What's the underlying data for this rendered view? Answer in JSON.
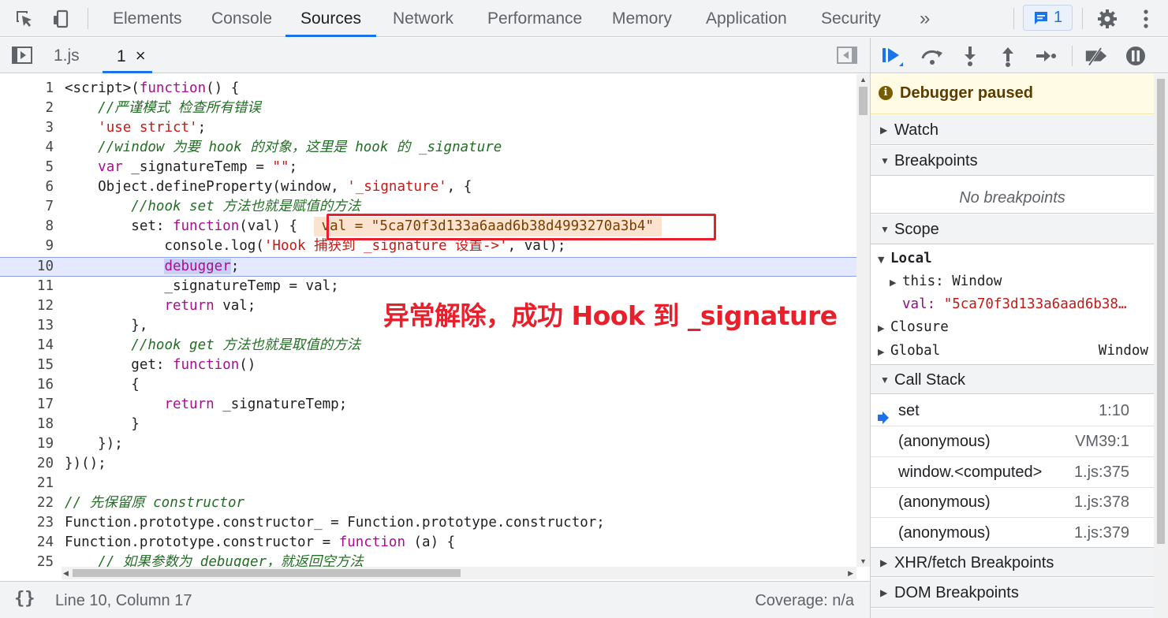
{
  "toolbar": {
    "tabs": [
      "Elements",
      "Console",
      "Sources",
      "Network",
      "Performance",
      "Memory",
      "Application",
      "Security"
    ],
    "active_tab": "Sources",
    "more_symbol": "»",
    "message_count": "1"
  },
  "editor": {
    "file_tabs": [
      {
        "label": "1.js"
      },
      {
        "label": "1",
        "close": "×"
      }
    ],
    "current_line": 10,
    "inline_value": "val = \"5ca70f3d133a6aad6b38d4993270a3b4\"",
    "annotation": "异常解除，成功 Hook 到 _signature",
    "lines": [
      "<script>(function() {",
      "    //严谨模式 检查所有错误",
      "    'use strict';",
      "    //window 为要 hook 的对象，这里是 hook 的 _signature",
      "    var _signatureTemp = \"\";",
      "    Object.defineProperty(window, '_signature', {",
      "        //hook set 方法也就是赋值的方法",
      "        set: function(val) {",
      "            console.log('Hook 捕获到 _signature 设置->', val);",
      "            debugger;",
      "            _signatureTemp = val;",
      "            return val;",
      "        },",
      "        //hook get 方法也就是取值的方法",
      "        get: function()",
      "        {",
      "            return _signatureTemp;",
      "        }",
      "    });",
      "})();",
      "",
      "// 先保留原 constructor",
      "Function.prototype.constructor_ = Function.prototype.constructor;",
      "Function.prototype.constructor = function (a) {",
      "    // 如果参数为 debugger，就返回空方法"
    ]
  },
  "status": {
    "braces": "{}",
    "position": "Line 10, Column 17",
    "coverage": "Coverage: n/a"
  },
  "debugger": {
    "paused_text": "Debugger paused",
    "sections": {
      "watch": "Watch",
      "breakpoints": "Breakpoints",
      "no_breakpoints": "No breakpoints",
      "scope": "Scope",
      "call_stack": "Call Stack",
      "xhr": "XHR/fetch Breakpoints",
      "dom": "DOM Breakpoints"
    },
    "scope": {
      "local": "Local",
      "this_key": "this:",
      "this_val": "Window",
      "val_key": "val:",
      "val_val": "\"5ca70f3d133a6aad6b38…",
      "closure": "Closure",
      "global": "Global",
      "global_val": "Window"
    },
    "call_stack": [
      {
        "fn": "set",
        "loc": "1:10"
      },
      {
        "fn": "(anonymous)",
        "loc": "VM39:1"
      },
      {
        "fn": "window.<computed>",
        "loc": "1.js:375"
      },
      {
        "fn": "(anonymous)",
        "loc": "1.js:378"
      },
      {
        "fn": "(anonymous)",
        "loc": "1.js:379"
      }
    ]
  },
  "colors": {
    "accent": "#1a73e8",
    "annotation_red": "#e8202c",
    "keyword": "#aa0d91",
    "string": "#c41a16",
    "comment": "#236e25"
  }
}
